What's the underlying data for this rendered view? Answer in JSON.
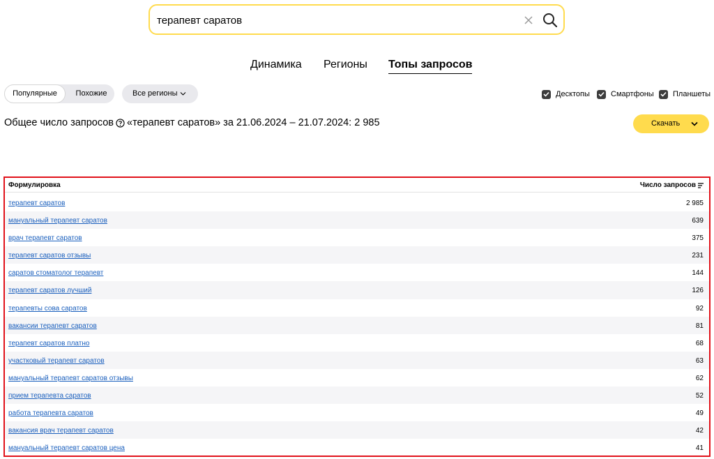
{
  "search": {
    "value": "терапевт саратов",
    "clear_icon": "close-icon",
    "search_icon": "search-icon"
  },
  "tabs": [
    {
      "label": "Динамика",
      "active": false
    },
    {
      "label": "Регионы",
      "active": false
    },
    {
      "label": "Топы запросов",
      "active": true
    }
  ],
  "mode_toggle": {
    "popular": "Популярные",
    "similar": "Похожие",
    "active": "popular"
  },
  "regions_label": "Все регионы",
  "devices": [
    {
      "label": "Десктопы",
      "checked": true
    },
    {
      "label": "Смартфоны",
      "checked": true
    },
    {
      "label": "Планшеты",
      "checked": true
    }
  ],
  "summary": {
    "prefix": "Общее число запросов",
    "suffix": "«терапевт саратов» за 21.06.2024 – 21.07.2024: 2 985"
  },
  "download_label": "Скачать",
  "table": {
    "col_query": "Формулировка",
    "col_count": "Число запросов",
    "rows": [
      {
        "query": "терапевт саратов",
        "count": "2 985"
      },
      {
        "query": "мануальный терапевт саратов",
        "count": "639"
      },
      {
        "query": "врач терапевт саратов",
        "count": "375"
      },
      {
        "query": "терапевт саратов отзывы",
        "count": "231"
      },
      {
        "query": "саратов стоматолог терапевт",
        "count": "144"
      },
      {
        "query": "терапевт саратов лучший",
        "count": "126"
      },
      {
        "query": "терапевты сова саратов",
        "count": "92"
      },
      {
        "query": "вакансии терапевт саратов",
        "count": "81"
      },
      {
        "query": "терапевт саратов платно",
        "count": "68"
      },
      {
        "query": "участковый терапевт саратов",
        "count": "63"
      },
      {
        "query": "мануальный терапевт саратов отзывы",
        "count": "62"
      },
      {
        "query": "прием терапевта саратов",
        "count": "52"
      },
      {
        "query": "работа терапевта саратов",
        "count": "49"
      },
      {
        "query": "вакансия врач терапевт саратов",
        "count": "42"
      },
      {
        "query": "мануальный терапевт саратов цена",
        "count": "41"
      }
    ]
  },
  "colors": {
    "accent_yellow": "#ffdb4d",
    "link_blue": "#1a5fbd",
    "highlight_red": "#e1111a"
  }
}
